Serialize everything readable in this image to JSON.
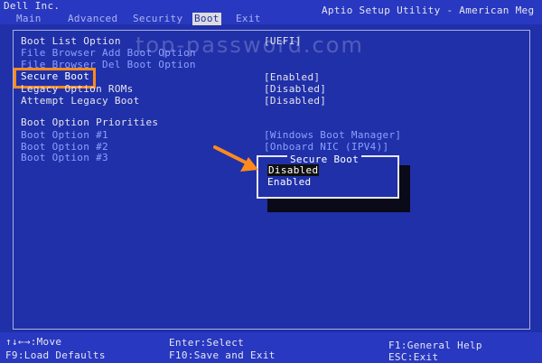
{
  "header": {
    "vendor": "Dell Inc.",
    "utility_title": "Aptio Setup Utility - American Meg",
    "tabs": [
      {
        "label": "Main"
      },
      {
        "label": "Advanced"
      },
      {
        "label": "Security"
      },
      {
        "label": "Boot"
      },
      {
        "label": "Exit"
      }
    ],
    "active_tab": "Boot"
  },
  "watermark": "top-password.com",
  "settings": [
    {
      "label": "Boot List Option",
      "value": "[UEFI]"
    },
    {
      "label": "File Browser Add Boot Option",
      "value": ""
    },
    {
      "label": "File Browser Del Boot Option",
      "value": ""
    },
    {
      "label": "Secure Boot",
      "value": "[Enabled]"
    },
    {
      "label": "Legacy Option ROMs",
      "value": "[Disabled]"
    },
    {
      "label": "Attempt Legacy Boot",
      "value": "[Disabled]"
    },
    {
      "label": "Boot Option Priorities",
      "value": ""
    },
    {
      "label": "Boot Option #1",
      "value": "[Windows Boot Manager]"
    },
    {
      "label": "Boot Option #2",
      "value": "[Onboard NIC (IPV4)]"
    },
    {
      "label": "Boot Option #3",
      "value": ""
    }
  ],
  "popup": {
    "title": "Secure Boot",
    "options": [
      "Disabled",
      "Enabled"
    ],
    "selected": "Disabled"
  },
  "status_bar": {
    "move": "↑↓←→:Move",
    "load_defaults": "F9:Load Defaults",
    "select": "Enter:Select",
    "save_exit": "F10:Save and Exit",
    "help": "F1:General Help",
    "exit": "ESC:Exit"
  },
  "colors": {
    "background": "#2030a8",
    "highlight_box": "#ff8a1c",
    "arrow": "#ff8a1c",
    "active_tab_bg": "#dcdcdc"
  }
}
